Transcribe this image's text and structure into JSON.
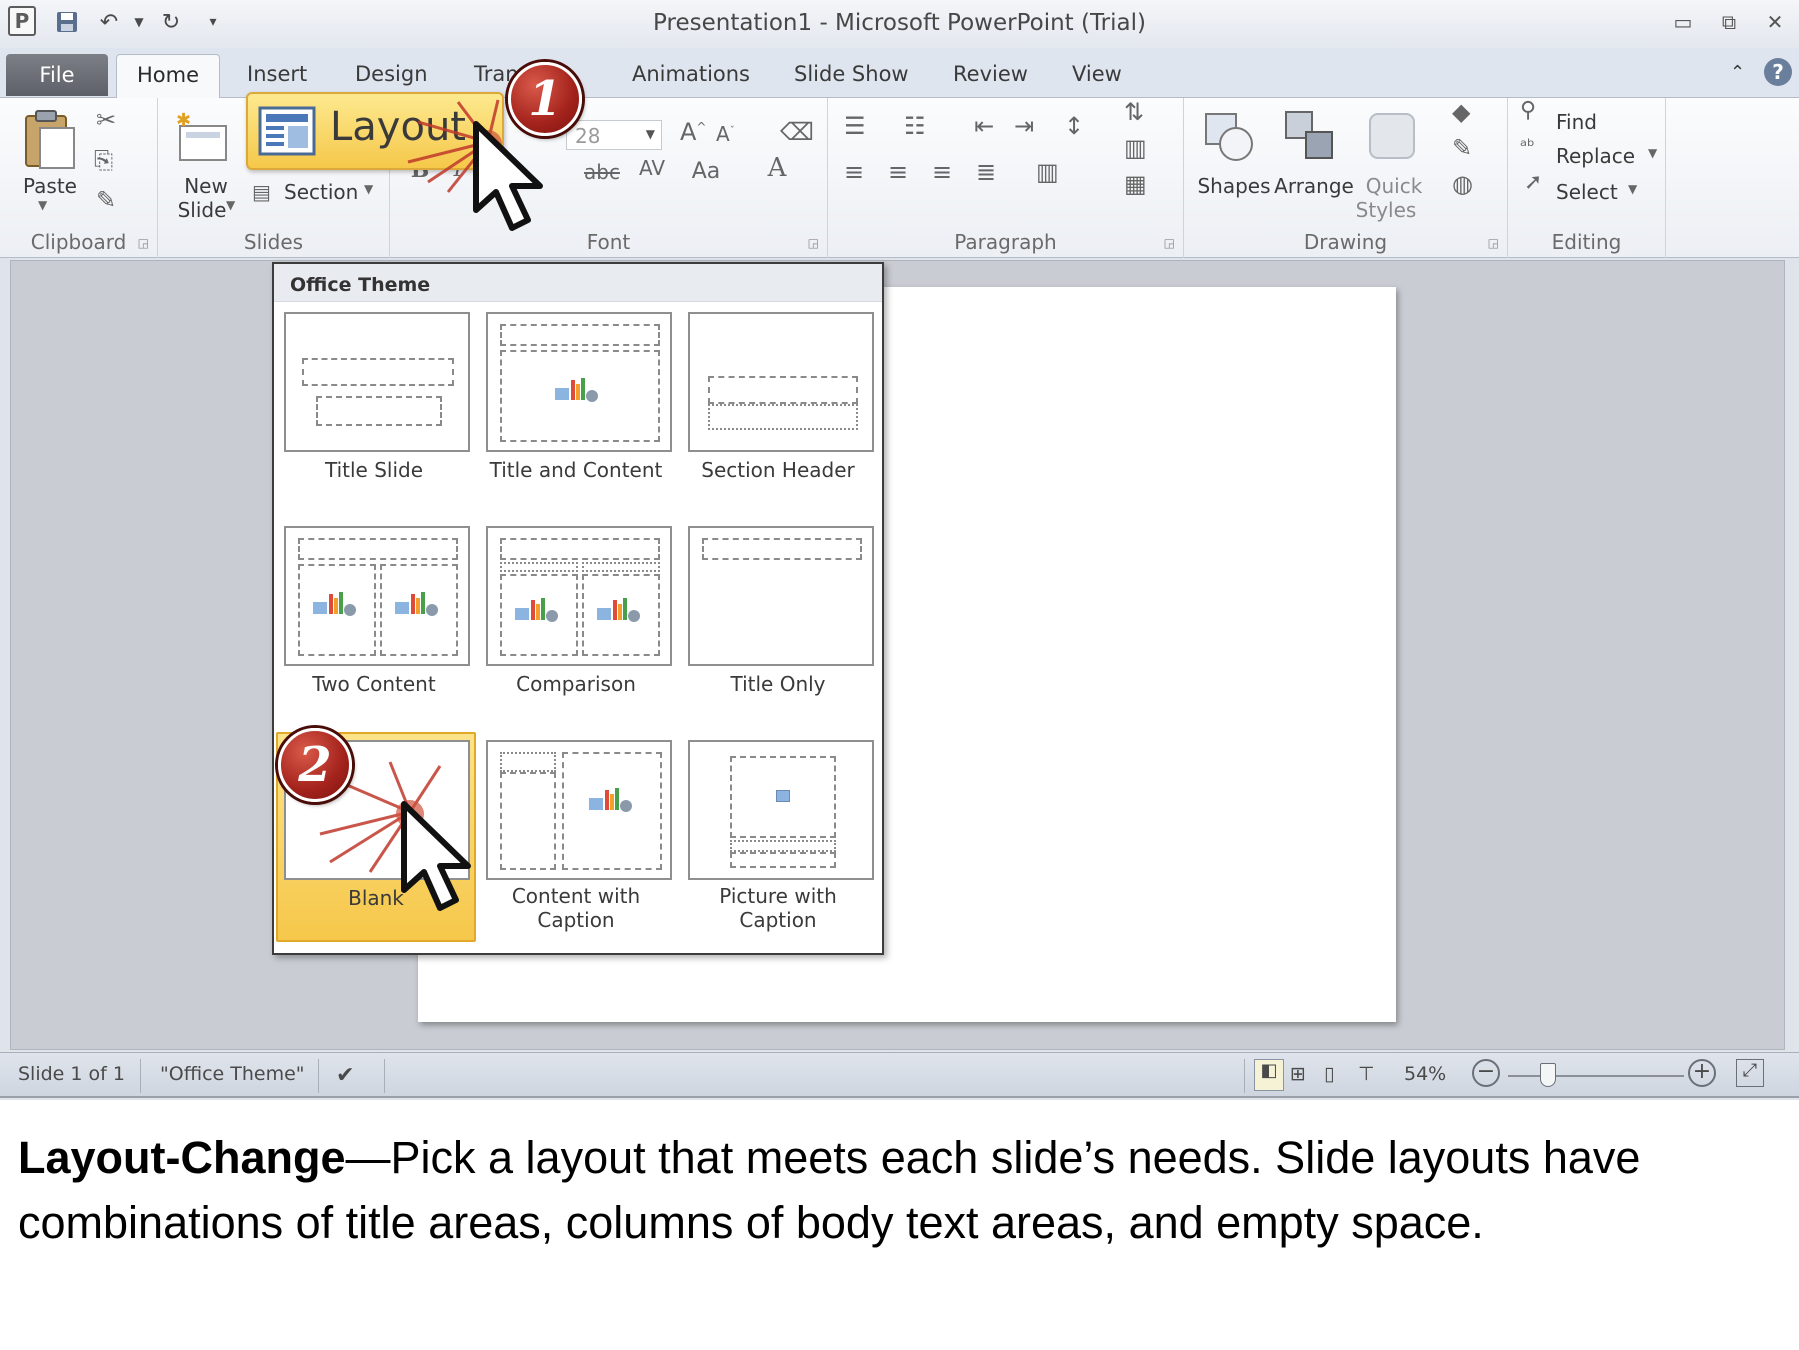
{
  "window": {
    "title": "Presentation1  -  Microsoft PowerPoint (Trial)",
    "app_icon_letter": "P"
  },
  "tabs": {
    "file": "File",
    "home": "Home",
    "insert": "Insert",
    "design": "Design",
    "transitions": "Tran",
    "animations": "Animations",
    "slide_show": "Slide Show",
    "review": "Review",
    "view": "View"
  },
  "ribbon": {
    "clipboard": {
      "label": "Clipboard",
      "paste": "Paste"
    },
    "slides": {
      "label": "Slides",
      "new_slide_line1": "New",
      "new_slide_line2": "Slide",
      "section": "Section"
    },
    "font": {
      "label": "Font",
      "size": "28",
      "bold": "B",
      "italic": "I",
      "strike": "abc",
      "spacing": "AV",
      "case": "Aa",
      "color": "A"
    },
    "paragraph": {
      "label": "Paragraph"
    },
    "drawing": {
      "label": "Drawing",
      "shapes": "Shapes",
      "arrange": "Arrange",
      "quick_styles_line1": "Quick",
      "quick_styles_line2": "Styles"
    },
    "editing": {
      "label": "Editing",
      "find": "Find",
      "replace": "Replace",
      "select": "Select"
    }
  },
  "callout": {
    "label": "Layout",
    "step1": "1",
    "step2": "2"
  },
  "gallery": {
    "header": "Office Theme",
    "layouts": [
      {
        "name": "Title Slide"
      },
      {
        "name": "Title and Content"
      },
      {
        "name": "Section Header"
      },
      {
        "name": "Two Content"
      },
      {
        "name": "Comparison"
      },
      {
        "name": "Title Only"
      },
      {
        "name": "Blank"
      },
      {
        "name_line1": "Content with",
        "name_line2": "Caption"
      },
      {
        "name_line1": "Picture with",
        "name_line2": "Caption"
      }
    ]
  },
  "statusbar": {
    "slide": "Slide 1 of 1",
    "theme": "\"Office Theme\"",
    "zoom": "54%"
  },
  "caption": {
    "bold": "Layout-Change",
    "line1": "—Pick a layout that meets each slide’s needs.  Slide layouts have",
    "line2": "combinations of title areas, columns of body text areas, and empty space."
  },
  "colors": {
    "accent_gold": "#f6c74a",
    "badge_red": "#a3221c",
    "file_tab": "#5d6068"
  }
}
